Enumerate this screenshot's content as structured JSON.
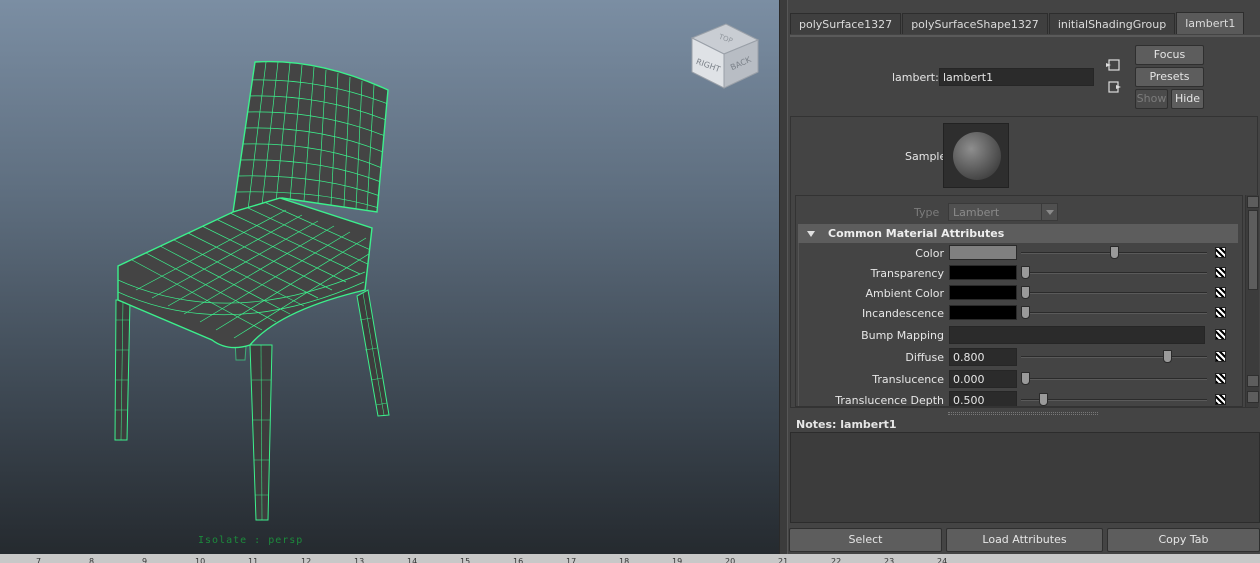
{
  "viewport": {
    "camera_label": "Isolate : persp",
    "viewcube": {
      "face_right": "RIGHT",
      "face_back": "BACK",
      "face_top": "TOP"
    }
  },
  "timeline": {
    "ticks": [
      "7",
      "8",
      "9",
      "10",
      "11",
      "12",
      "13",
      "14",
      "15",
      "16",
      "17",
      "18",
      "19",
      "20",
      "21",
      "22",
      "23",
      "24"
    ]
  },
  "attribute_editor": {
    "tabs": [
      {
        "label": "polySurface1327",
        "active": false
      },
      {
        "label": "polySurfaceShape1327",
        "active": false
      },
      {
        "label": "initialShadingGroup",
        "active": false
      },
      {
        "label": "lambert1",
        "active": true
      }
    ],
    "node": {
      "label": "lambert:",
      "value": "lambert1"
    },
    "buttons": {
      "focus": "Focus",
      "presets": "Presets",
      "show": "Show",
      "hide": "Hide"
    },
    "sample_label": "Sample",
    "type": {
      "label": "Type",
      "value": "Lambert"
    },
    "section_title": "Common Material Attributes",
    "attributes": [
      {
        "label": "Color",
        "kind": "color",
        "swatch": "#808080",
        "slider": 0.5
      },
      {
        "label": "Transparency",
        "kind": "color",
        "swatch": "#000000",
        "slider": 0.0
      },
      {
        "label": "Ambient Color",
        "kind": "color",
        "swatch": "#000000",
        "slider": 0.0
      },
      {
        "label": "Incandescence",
        "kind": "color",
        "swatch": "#000000",
        "slider": 0.0
      },
      {
        "label": "Bump Mapping",
        "kind": "map",
        "value": ""
      },
      {
        "label": "Diffuse",
        "kind": "number",
        "value": "0.800",
        "slider": 0.8
      },
      {
        "label": "Translucence",
        "kind": "number",
        "value": "0.000",
        "slider": 0.0
      },
      {
        "label": "Translucence Depth",
        "kind": "number",
        "value": "0.500",
        "slider": 0.1
      }
    ],
    "notes_label": "Notes:  lambert1",
    "bottom_buttons": {
      "select": "Select",
      "load": "Load Attributes",
      "copy": "Copy Tab"
    }
  },
  "colors": {
    "wire": "#3cf08c",
    "panel_bg": "#444444",
    "field_bg": "#2b2b2b",
    "active_tab": "#5a5a5a"
  }
}
